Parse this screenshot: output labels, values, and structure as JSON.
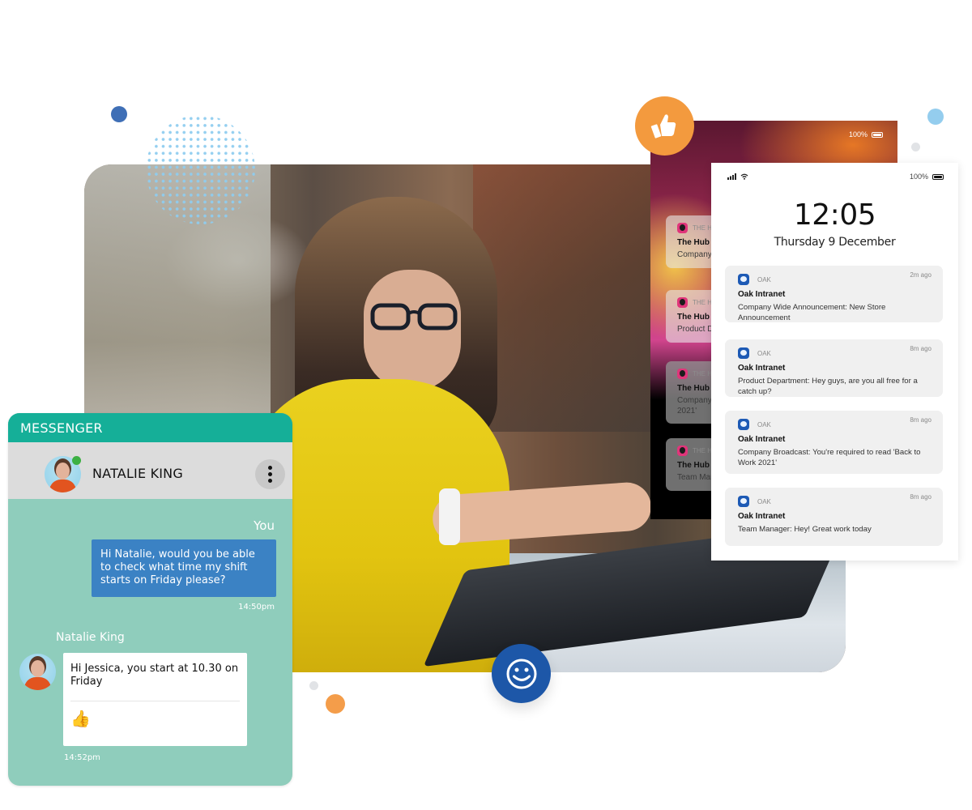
{
  "decor": {
    "colors": {
      "accent_blue": "#1d57a8",
      "accent_orange": "#f39a3e",
      "dot_blue": "#3f6fb6",
      "dot_lightblue": "#94cdee",
      "halftone": "#8fcdf0"
    }
  },
  "photo": {
    "description": "woman in yellow t-shirt and glasses checking smartwatch while typing on laptop"
  },
  "messenger": {
    "title": "MESSENGER",
    "contact_name": "NATALIE KING",
    "contact_online": true,
    "more_icon": "vertical-ellipsis",
    "messages": [
      {
        "sender": "You",
        "text": "Hi Natalie, would you be able to check what time my shift starts on Friday please?",
        "time": "14:50pm",
        "direction": "outgoing"
      },
      {
        "sender": "Natalie King",
        "text": "Hi Jessica, you start at 10.30 on Friday",
        "reaction": "👍",
        "time": "14:52pm",
        "direction": "incoming"
      }
    ],
    "colors": {
      "header": "#15af98",
      "contact_bar": "#dcdcdc",
      "background": "#8fcdbc",
      "outgoing_bubble": "#3b82c4",
      "online": "#3cb043"
    }
  },
  "phone_back": {
    "battery": "100%",
    "notifications": [
      {
        "app": "THE H",
        "title": "The Hub",
        "body": "Company"
      },
      {
        "app": "THE H",
        "title": "The Hub",
        "body": "Product De"
      },
      {
        "app": "THE H",
        "title": "The Hub",
        "body": "Company\n2021'"
      },
      {
        "app": "THE H",
        "title": "The Hub",
        "body": "Team Man"
      }
    ]
  },
  "phone_front": {
    "battery": "100%",
    "time": "12:05",
    "date": "Thursday 9 December",
    "notifications": [
      {
        "app": "OAK",
        "title": "Oak Intranet",
        "body": "Company Wide Announcement: New Store Announcement",
        "time": "2m ago"
      },
      {
        "app": "OAK",
        "title": "Oak Intranet",
        "body": "Product Department: Hey guys, are you all free for a catch up?",
        "time": "8m ago"
      },
      {
        "app": "OAK",
        "title": "Oak Intranet",
        "body": "Company Broadcast: You're required to read 'Back to Work 2021'",
        "time": "8m ago"
      },
      {
        "app": "OAK",
        "title": "Oak Intranet",
        "body": "Team Manager: Hey! Great work today",
        "time": "8m ago"
      }
    ]
  },
  "badges": {
    "like_icon": "thumbs-up",
    "smile_icon": "smiley-face"
  }
}
